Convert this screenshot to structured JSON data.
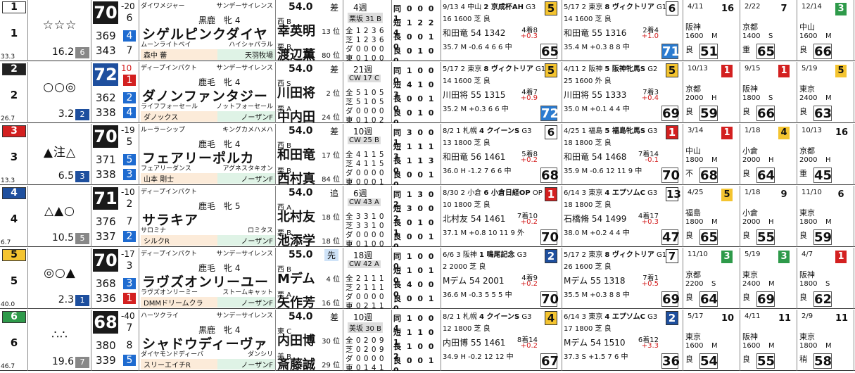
{
  "colors": {
    "frame1": "#ffffff",
    "frame2": "#222222",
    "frame3": "#d32020",
    "frame4": "#1e4f9e",
    "frame5": "#f4c430",
    "frame6": "#2e9a4a"
  },
  "horses": [
    {
      "waku": "1",
      "num": "1",
      "odds_rank_small": "33.3",
      "marks": "☆☆☆",
      "odds": "16.2",
      "pop": "6",
      "score": "70",
      "diff": "-20",
      "sub1": "6",
      "r1": "369",
      "p1": "4",
      "r2": "343",
      "p2": "7",
      "sire": "ダイワメジャー",
      "sire_sire": "サンデーサイレンス",
      "sex": "黒鹿　牝 4",
      "name": "シゲルピンクダイヤ",
      "dam": "ムーンライトベイ",
      "dam_sire": "ハイシャパラル",
      "owner": "森中 蕃",
      "breeder": "天羽牧場",
      "weight": "54.0",
      "style": "差",
      "wg": "西 B",
      "jockey": "幸英明",
      "jrank": "13 位",
      "tg": "栗 B",
      "trainer": "渡辺薫",
      "trank": "80 位",
      "rest": "4週",
      "cw": "栗坂 31 B",
      "rotations": [
        "同 0 0 0 1",
        "短 1 2 2 4",
        "長 0 0 1 0",
        "良 0 1 0 0"
      ],
      "grades": [
        "全 1 2 3 6",
        "芝 1 2 3 6",
        "ダ 0 0 0 0",
        "東 0 1 0 0"
      ],
      "r": [
        [
          "9/13",
          "4 中山",
          "2 京成杯AH",
          "G3",
          "5",
          "16 1600 芝 良",
          "和田竜 54 1342",
          "4着8",
          "+0.3",
          "35.7 M -0.6 4 6 6 中",
          "65"
        ],
        [
          "5/17",
          "2 東京",
          "8 ヴィクトリア",
          "G1",
          "6",
          "14 1600 芝 良",
          "和田竜 55 1316",
          "2着4",
          "+1.0",
          "35.4 M +0.3 8 8 中",
          "71"
        ]
      ],
      "s": [
        [
          "4/11",
          "16",
          "阪神",
          "1600",
          "M",
          "良",
          "51"
        ],
        [
          "2/22",
          "7",
          "京都",
          "1400",
          "S",
          "重",
          "65"
        ],
        [
          "12/14",
          "3",
          "中山",
          "1600",
          "M",
          "良",
          "66"
        ]
      ]
    },
    {
      "waku": "2",
      "num": "2",
      "odds_rank_small": "26.7",
      "marks": "○○◎",
      "odds": "3.2",
      "pop": "2",
      "score": "72",
      "diff": "10",
      "sub1": "1",
      "r1": "362",
      "p1": "2",
      "r2": "338",
      "p2": "4",
      "sire": "ディープインパクト",
      "sire_sire": "サンデーサイレンス",
      "sex": "鹿毛　牝 4",
      "name": "ダノンファンタジー",
      "dam": "ライフフォーセール",
      "dam_sire": "ノットフォーセール",
      "owner": "ダノックス",
      "breeder": "ノーザンF",
      "weight": "54.0",
      "style": "差",
      "wg": "西 S",
      "jockey": "川田将",
      "jrank": "2 位",
      "tg": "栗 A",
      "trainer": "中内田",
      "trank": "24 位",
      "rest": "21週",
      "cw": "CW 17 C",
      "rotations": [
        "同 1 0 0 0",
        "短 4 1 0 3",
        "長 0 0 1 0",
        "良 0 1 0 0"
      ],
      "grades": [
        "全 5 1 0 5",
        "芝 5 1 0 5",
        "ダ 0 0 0 0",
        "東 0 1 0 2"
      ],
      "r": [
        [
          "5/17",
          "2 東京",
          "8 ヴィクトリア",
          "G1",
          "5",
          "14 1600 芝 良",
          "川田将 55 1315",
          "4着7",
          "+0.9",
          "35.2 M +0.3 6 6 中",
          "72"
        ],
        [
          "4/11",
          "2 阪神",
          "5 阪神牝馬S",
          "G2",
          "5",
          "25 1600 外 良",
          "川田将 55 1333",
          "7着3",
          "+0.4",
          "35.0 M +0.1 4 4 中",
          "69"
        ]
      ],
      "s": [
        [
          "10/13",
          "1",
          "京都",
          "2000",
          "H",
          "良",
          "59"
        ],
        [
          "9/15",
          "1",
          "阪神",
          "1800",
          "S",
          "良",
          "66"
        ],
        [
          "5/19",
          "5",
          "東京",
          "2400",
          "M",
          "良",
          "63"
        ]
      ]
    },
    {
      "waku": "3",
      "num": "3",
      "odds_rank_small": "13.3",
      "marks": "▲注△",
      "odds": "6.5",
      "pop": "3",
      "score": "70",
      "diff": "-19",
      "sub1": "5",
      "r1": "371",
      "p1": "5",
      "r2": "338",
      "p2": "3",
      "sire": "ルーラーシップ",
      "sire_sire": "キングカメハメハ",
      "sex": "鹿毛　牝 4",
      "name": "フェアリーポルカ",
      "dam": "フェアリーダンス",
      "dam_sire": "アグネスタキオン",
      "owner": "山本 剛士",
      "breeder": "ノーザンF",
      "weight": "54.0",
      "style": "差",
      "wg": "西 B",
      "jockey": "和田竜",
      "jrank": "17 位",
      "tg": "栗 B",
      "trainer": "西村真",
      "trank": "84 位",
      "rest": "10週",
      "cw": "CW 25 B",
      "rotations": [
        "同 3 0 0 1",
        "短 1 1 1 3",
        "長 1 1 3 0",
        "良 0 0 1 0"
      ],
      "grades": [
        "全 4 1 1 5",
        "芝 4 1 1 5",
        "ダ 0 0 0 0",
        "東 0 0 0 1"
      ],
      "r": [
        [
          "8/2",
          "1 札幌",
          "4 クイーンS",
          "G3",
          "6",
          "13 1800 芝 良",
          "和田竜 56 1461",
          "5着8",
          "+0.2",
          "36.0 H -1.2 7 6 6 中",
          "68"
        ],
        [
          "4/25",
          "1 福島",
          "5 福島牝馬S",
          "G3",
          "1",
          "18 1800 芝 良",
          "和田竜 54 1468",
          "7着14",
          "-0.1",
          "35.9 M -0.6 12 11 9 中",
          "70"
        ]
      ],
      "s": [
        [
          "3/14",
          "1",
          "中山",
          "1800",
          "M",
          "不",
          "68"
        ],
        [
          "1/18",
          "4",
          "小倉",
          "2000",
          "H",
          "良",
          "64"
        ],
        [
          "10/13",
          "16",
          "京都",
          "2000",
          "H",
          "重",
          "45"
        ]
      ]
    },
    {
      "waku": "4",
      "num": "4",
      "odds_rank_small": "6.7",
      "marks": "△▲○",
      "odds": "10.5",
      "pop": "5",
      "score": "71",
      "diff": "-10",
      "sub1": "2",
      "r1": "376",
      "p1": "7",
      "r2": "337",
      "p2": "2",
      "sire": "ディープインパクト",
      "sire_sire": "",
      "sex": "鹿毛　牝 5",
      "name": "サラキア",
      "dam": "サロミナ",
      "dam_sire": "ロミタス",
      "owner": "シルクR",
      "breeder": "ノーザンF",
      "weight": "54.0",
      "style": "追",
      "wg": "西 A",
      "jockey": "北村友",
      "jrank": "18 位",
      "tg": "栗 B",
      "trainer": "池添学",
      "trank": "18 位",
      "rest": "6週",
      "cw": "CW 43 A",
      "rotations": [
        "同 1 3 0 2",
        "短 3 0 0 2",
        "長 0 1 0 1",
        "良 0 0 1 0"
      ],
      "grades": [
        "全 3 3 1 0",
        "芝 3 3 1 0",
        "ダ 0 0 0 0",
        "東 0 1 0 0"
      ],
      "r": [
        [
          "8/30",
          "2 小倉",
          "6 小倉日経OP",
          "OP",
          "1",
          "10 1800 芝 良",
          "北村友 54 1461",
          "7着10",
          "+0.2",
          "37.1 M +0.8 10 11 9 外",
          "70"
        ],
        [
          "6/14",
          "3 東京",
          "4 エプソムC",
          "G3",
          "13",
          "18 1800 芝 良",
          "石橋脩 54 1499",
          "4着17",
          "+0.3",
          "38.0 M +0.2 4 4 中",
          "47"
        ]
      ],
      "s": [
        [
          "4/25",
          "5",
          "福島",
          "1800",
          "M",
          "良",
          "65"
        ],
        [
          "1/18",
          "9",
          "小倉",
          "2000",
          "H",
          "良",
          "55"
        ],
        [
          "11/10",
          "6",
          "東京",
          "1800",
          "M",
          "良",
          "59"
        ]
      ]
    },
    {
      "waku": "5",
      "num": "5",
      "odds_rank_small": "40.0",
      "marks": "◎○▲",
      "odds": "2.3",
      "pop": "1",
      "score": "70",
      "diff": "-17",
      "sub1": "3",
      "r1": "368",
      "p1": "3",
      "r2": "336",
      "p2": "1",
      "sire": "ディープインパクト",
      "sire_sire": "サンデーサイレンス",
      "sex": "鹿毛　牝 4",
      "name": "ラヴズオンリーユー",
      "dam": "ラヴズオンリーミー",
      "dam_sire": "ストームキャット",
      "owner": "DMMドリームクラ",
      "breeder": "ノーザンF",
      "weight": "55.0",
      "style": "先",
      "wg": "西 B",
      "jockey": "Mデム",
      "jrank": "4 位",
      "tg": "栗 A",
      "trainer": "矢作芳",
      "trank": "16 位",
      "rest": "18週",
      "cw": "CW 42 A",
      "rotations": [
        "同 1 0 0 0",
        "短 1 0 1 0",
        "長 4 0 0 0",
        "良 0 0 1 0"
      ],
      "grades": [
        "全 2 1 1 1",
        "芝 2 1 1 1",
        "ダ 0 0 0 0",
        "東 0 2 1 1"
      ],
      "r": [
        [
          "6/6",
          "3 阪神",
          "1 鳴尾記念",
          "G3",
          "2",
          "2 2000 芝 良",
          "Mデム 54 2001",
          "4着9",
          "+0.2",
          "36.6 M -0.3 5 5 5 中",
          "70"
        ],
        [
          "5/17",
          "2 東京",
          "8 ヴィクトリア",
          "G1",
          "7",
          "26 1600 芝 良",
          "Mデム 55 1318",
          "7着1",
          "+0.5",
          "35.5 M +0.3 8 8 中",
          "69"
        ]
      ],
      "s": [
        [
          "11/10",
          "3",
          "京都",
          "2200",
          "S",
          "良",
          "64"
        ],
        [
          "5/19",
          "3",
          "東京",
          "2400",
          "M",
          "良",
          "69"
        ],
        [
          "4/7",
          "1",
          "阪神",
          "1800",
          "S",
          "良",
          "62"
        ]
      ]
    },
    {
      "waku": "6",
      "num": "6",
      "odds_rank_small": "46.7",
      "marks": "∴∴",
      "odds": "19.6",
      "pop": "7",
      "score": "68",
      "diff": "-40",
      "sub1": "7",
      "r1": "380",
      "p1": "8",
      "r2": "339",
      "p2": "5",
      "sire": "ハーツクライ",
      "sire_sire": "サンデーサイレンス",
      "sex": "黒鹿　牝 4",
      "name": "シャドウディーヴァ",
      "dam": "ダイヤモンドディーバ",
      "dam_sire": "ダンシリ",
      "owner": "スリーエイチR",
      "breeder": "ノーザンF",
      "weight": "54.0",
      "style": "差",
      "wg": "東 C",
      "jockey": "内田博",
      "jrank": "30 位",
      "tg": "美 B",
      "trainer": "斎藤誠",
      "trank": "29 位",
      "rest": "10週",
      "cw": "美坂 30 B",
      "rotations": [
        "同 1 0 0 4",
        "短 1 1 0 1",
        "長 1 0 0 2",
        "良 0 0 1 0"
      ],
      "grades": [
        "全 0 2 0 9",
        "芝 0 2 0 9",
        "ダ 0 0 0 0",
        "東 0 1 4 1"
      ],
      "r": [
        [
          "8/2",
          "1 札幌",
          "4 クイーンS",
          "G3",
          "4",
          "12 1800 芝 良",
          "内田博 55 1461",
          "8着14",
          "+0.2",
          "34.9 H -0.2 12 12 中",
          "67"
        ],
        [
          "6/14",
          "3 東京",
          "4 エプソムC",
          "G3",
          "2",
          "17 1800 芝 良",
          "Mデム 54 1510",
          "6着12",
          "+3.3",
          "37.3 S +1.5 7 6 中",
          "36"
        ]
      ],
      "s": [
        [
          "5/17",
          "10",
          "東京",
          "1600",
          "M",
          "良",
          "54"
        ],
        [
          "4/11",
          "11",
          "阪神",
          "1600",
          "M",
          "良",
          "55"
        ],
        [
          "2/9",
          "11",
          "東京",
          "1800",
          "M",
          "稍",
          "58"
        ]
      ]
    }
  ]
}
